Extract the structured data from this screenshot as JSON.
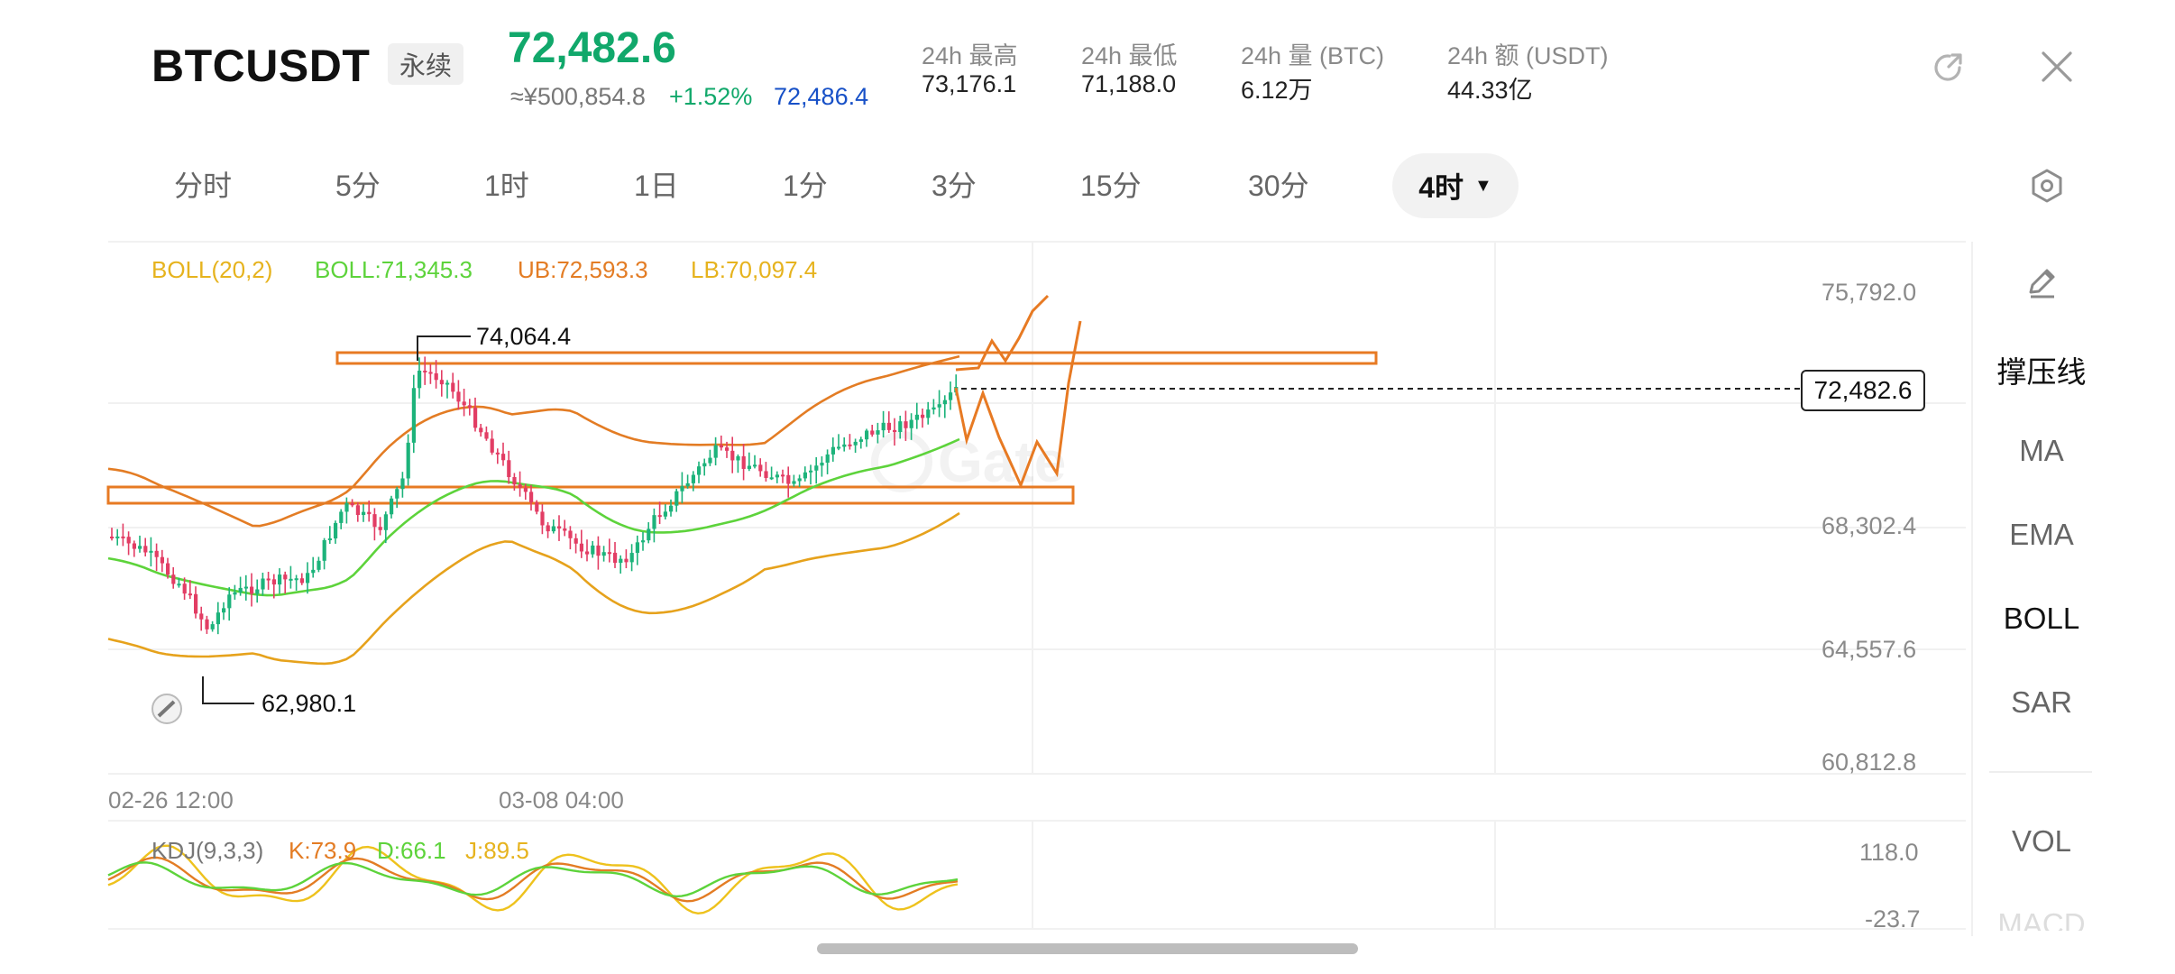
{
  "header": {
    "symbol": "BTCUSDT",
    "contract_badge": "永续",
    "last_price": "72,482.6",
    "cny_price": "≈¥500,854.8",
    "change_pct": "+1.52%",
    "mark_price": "72,486.4",
    "stats": [
      {
        "label": "24h  最高",
        "value": "73,176.1"
      },
      {
        "label": "24h  最低",
        "value": "71,188.0"
      },
      {
        "label": "24h  量 (BTC)",
        "value": "6.12万"
      },
      {
        "label": "24h  额 (USDT)",
        "value": "44.33亿"
      }
    ]
  },
  "intervals": {
    "tabs": [
      "分时",
      "5分",
      "1时",
      "1日",
      "1分",
      "3分",
      "15分",
      "30分"
    ],
    "active": "4时"
  },
  "boll_legend": {
    "params": "BOLL(20,2)",
    "mid": "BOLL:71,345.3",
    "upper": "UB:72,593.3",
    "lower": "LB:70,097.4"
  },
  "kdj_legend": {
    "params": "KDJ(9,3,3)",
    "k": "K:73.9",
    "d": "D:66.1",
    "j": "J:89.5"
  },
  "price_axis": [
    "75,792.0",
    "68,302.4",
    "64,557.6",
    "60,812.8"
  ],
  "kdj_axis": [
    "118.0",
    "-23.7"
  ],
  "time_axis": [
    "02-26 12:00",
    "03-08 04:00"
  ],
  "annotations": {
    "high_marker": "74,064.4",
    "low_marker": "62,980.1",
    "current_price_tag": "72,482.6",
    "watermark": "Gate"
  },
  "right_panel": {
    "items": [
      "撑压线",
      "MA",
      "EMA",
      "BOLL",
      "SAR",
      "VOL",
      "MACD"
    ],
    "selected": "BOLL"
  },
  "colors": {
    "up": "#1db37b",
    "down": "#e23d64",
    "boll_mid": "#5dd33b",
    "boll_band": "#e6a21c",
    "drawing": "#e77a23",
    "kdj_k": "#e37c24",
    "kdj_d": "#5dd33b",
    "kdj_j": "#eec21d"
  }
}
